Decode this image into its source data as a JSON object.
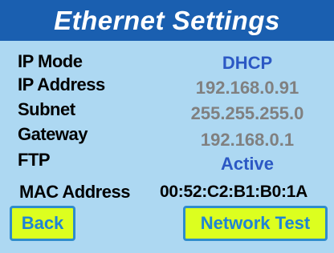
{
  "header": {
    "title": "Ethernet Settings"
  },
  "settings": [
    {
      "label": "IP Mode",
      "value": "DHCP",
      "accent": true
    },
    {
      "label": "IP Address",
      "value": "192.168.0.91",
      "accent": false
    },
    {
      "label": "Subnet",
      "value": "255.255.255.0",
      "accent": false
    },
    {
      "label": "Gateway",
      "value": "192.168.0.1",
      "accent": false
    },
    {
      "label": "FTP",
      "value": "Active",
      "accent": true
    }
  ],
  "mac": {
    "label": "MAC Address",
    "value": "00:52:C2:B1:B0:1A"
  },
  "buttons": {
    "back": "Back",
    "network_test": "Network Test"
  },
  "colors": {
    "title_bar": "#1a5fb0",
    "background": "#add8f2",
    "accent_value": "#2b58c4",
    "muted_value": "#808080",
    "button_fill": "#dcff1f",
    "button_text": "#1f84d6"
  }
}
